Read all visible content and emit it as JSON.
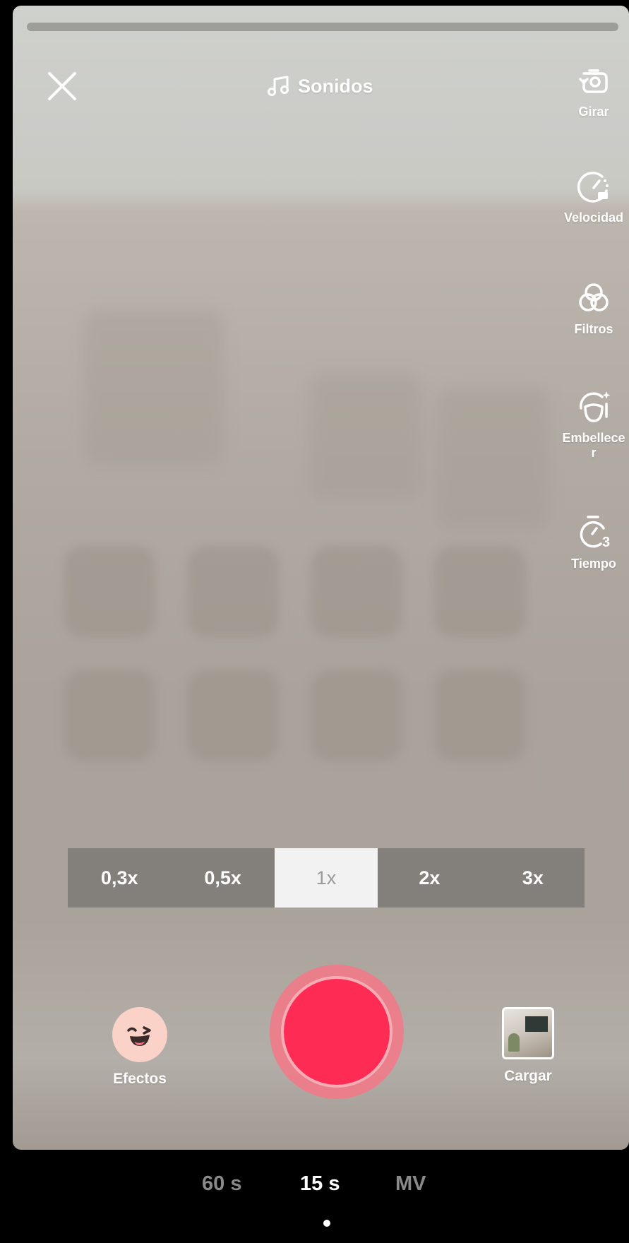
{
  "top_bar": {
    "close_icon": "close-x-icon",
    "sounds_icon": "music-note-icon",
    "sounds_label": "Sonidos"
  },
  "side_tools": [
    {
      "id": "flip",
      "icon": "flip-camera-icon",
      "label": "Girar"
    },
    {
      "id": "speed",
      "icon": "speed-gauge-icon",
      "label": "Velocidad"
    },
    {
      "id": "filters",
      "icon": "filters-circles-icon",
      "label": "Filtros"
    },
    {
      "id": "beautify",
      "icon": "beautify-face-icon",
      "label": "Embellecer"
    },
    {
      "id": "timer",
      "icon": "timer-3s-icon",
      "label": "Tiempo"
    }
  ],
  "zoom": {
    "options": [
      "0,3x",
      "0,5x",
      "1x",
      "2x",
      "3x"
    ],
    "selected": "1x"
  },
  "bottom_controls": {
    "effects_label": "Efectos",
    "effects_icon": "winking-face-icon",
    "upload_label": "Cargar",
    "upload_icon": "gallery-thumbnail-icon",
    "record_icon": "record-button"
  },
  "modes": {
    "items": [
      "60 s",
      "15 s",
      "MV"
    ],
    "selected": "15 s"
  },
  "colors": {
    "record": "#fe2c55",
    "record_ring": "#f47887",
    "background_bar": "#000000"
  }
}
